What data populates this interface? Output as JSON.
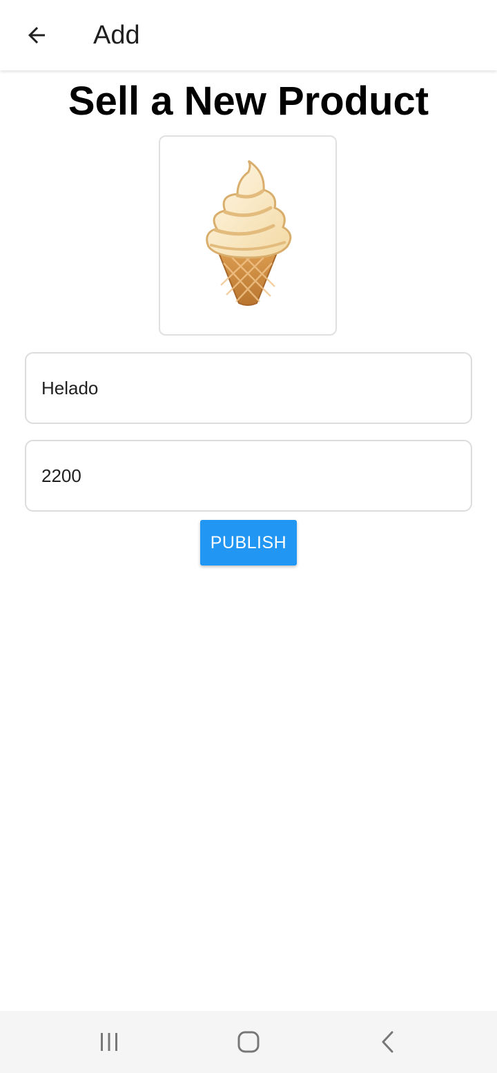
{
  "appbar": {
    "title": "Add",
    "back_icon": "arrow-left-icon"
  },
  "page": {
    "heading": "Sell a New Product"
  },
  "product_image": {
    "icon": "soft-ice-cream-icon"
  },
  "form": {
    "name_value": "Helado",
    "price_value": "2200",
    "publish_label": "PUBLISH"
  },
  "system_nav": {
    "recents_icon": "recents-icon",
    "home_icon": "home-icon",
    "back_icon": "back-chevron-icon"
  },
  "colors": {
    "accent": "#2196f3",
    "nav_bg": "#f5f5f5"
  }
}
